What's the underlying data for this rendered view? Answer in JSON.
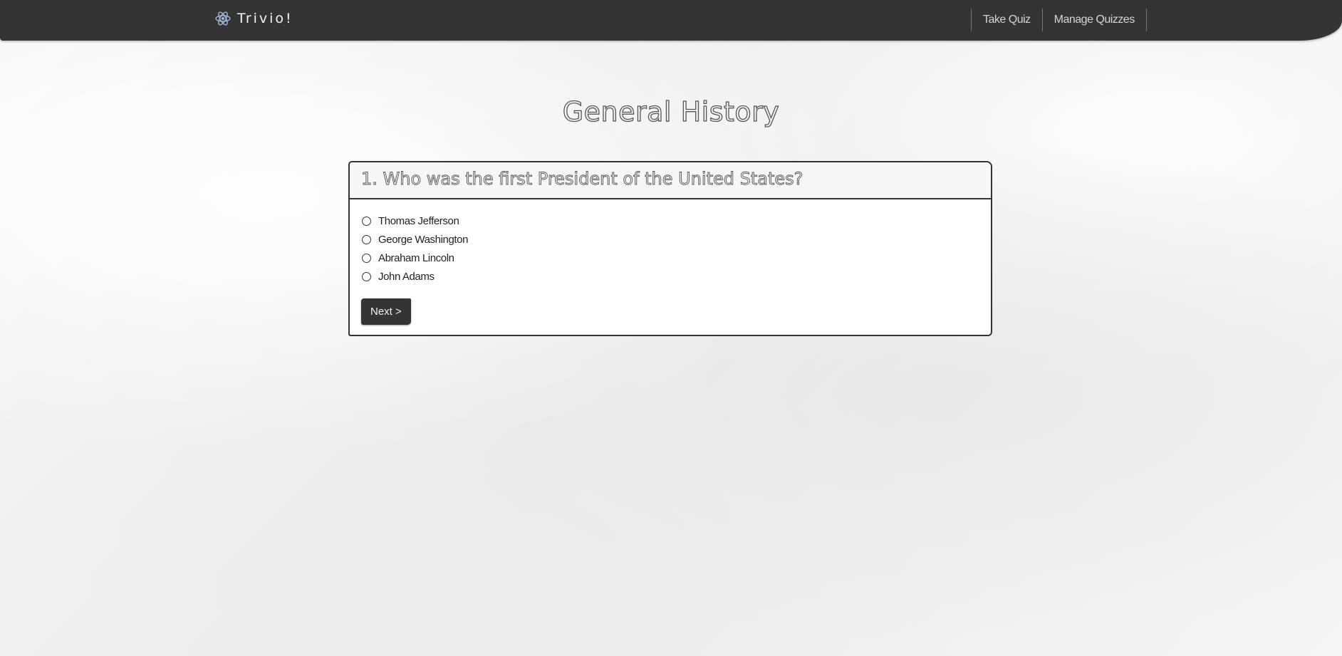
{
  "nav": {
    "brand": "Trivio!",
    "brand_icon": "atom-icon",
    "links": [
      "Take Quiz",
      "Manage Quizzes"
    ]
  },
  "quiz": {
    "title": "General History",
    "question": "1. Who was the first President of the United States?",
    "options": [
      "Thomas Jefferson",
      "George Washington",
      "Abraham Lincoln",
      "John Adams"
    ],
    "next_label": "Next >"
  },
  "colors": {
    "navbar": "#343434",
    "button": "#343434",
    "border": "#333333"
  }
}
